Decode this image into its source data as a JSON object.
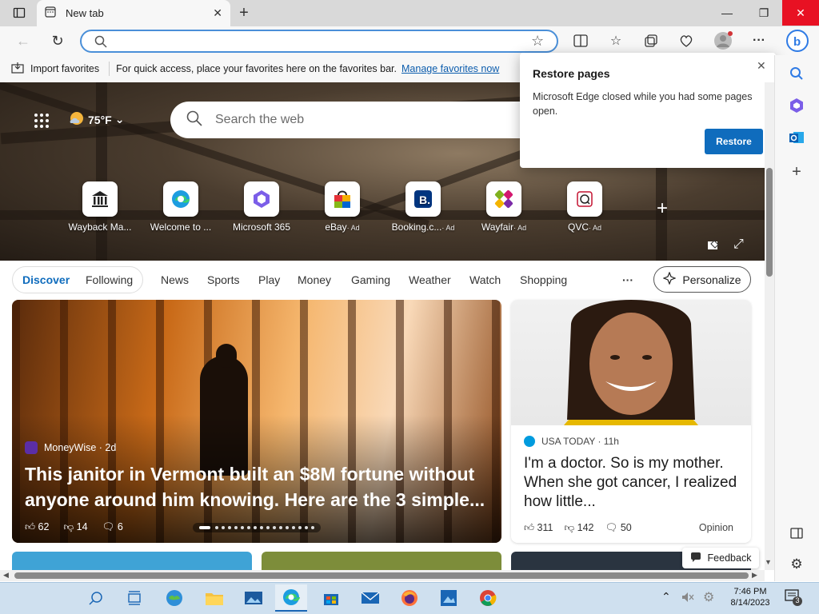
{
  "tab": {
    "title": "New tab"
  },
  "address": {
    "value": ""
  },
  "favorites_bar": {
    "import_label": "Import favorites",
    "message": "For quick access, place your favorites here on the favorites bar.",
    "manage_link": "Manage favorites now"
  },
  "weather": {
    "temp": "75°F"
  },
  "search": {
    "placeholder": "Search the web"
  },
  "tiles": [
    {
      "label": "Wayback Ma...",
      "ad": ""
    },
    {
      "label": "Welcome to ...",
      "ad": ""
    },
    {
      "label": "Microsoft 365",
      "ad": ""
    },
    {
      "label": "eBay",
      "ad": "· Ad"
    },
    {
      "label": "Booking.c...",
      "ad": "· Ad"
    },
    {
      "label": "Wayfair",
      "ad": "· Ad"
    },
    {
      "label": "QVC",
      "ad": "· Ad"
    }
  ],
  "popup": {
    "title": "Restore pages",
    "message": "Microsoft Edge closed while you had some pages open.",
    "button": "Restore"
  },
  "feed_nav": {
    "discover": "Discover",
    "following": "Following",
    "items": [
      "News",
      "Sports",
      "Play",
      "Money",
      "Gaming",
      "Weather",
      "Watch",
      "Shopping"
    ],
    "more": "···",
    "personalize": "Personalize"
  },
  "main_card": {
    "source": "MoneyWise · 2d",
    "headline": "This janitor in Vermont built an $8M fortune without anyone around him knowing. Here are the 3 simple...",
    "likes": "62",
    "dislikes": "14",
    "comments": "6"
  },
  "side_card": {
    "source": "USA TODAY · 11h",
    "headline": "I'm a doctor. So is my mother. When she got cancer, I realized how little...",
    "likes": "311",
    "dislikes": "142",
    "comments": "50",
    "tag": "Opinion"
  },
  "feedback": {
    "label": "Feedback"
  },
  "clock": {
    "time": "7:46 PM",
    "date": "8/14/2023"
  },
  "notifications": {
    "count": "3"
  },
  "colors": {
    "accent": "#0f6cbd",
    "close_red": "#e81123",
    "taskbar": "#cfe0ef"
  }
}
